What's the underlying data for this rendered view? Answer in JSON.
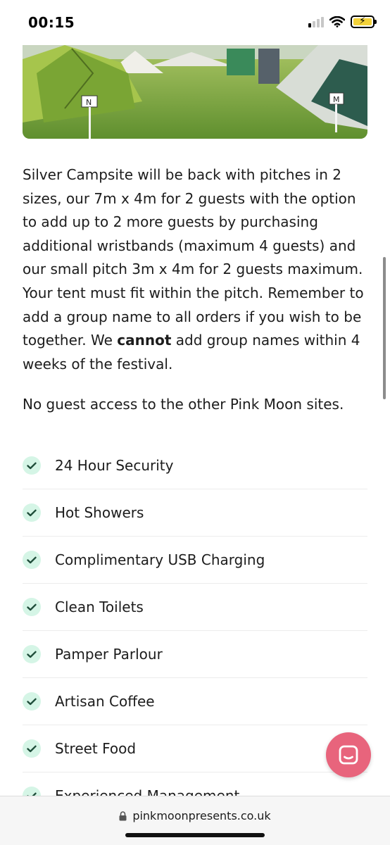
{
  "status_bar": {
    "time": "00:15"
  },
  "hero": {
    "pitch_markers": [
      "N",
      "M"
    ]
  },
  "intro": {
    "part1": "Silver Campsite will be back with pitches in 2 sizes, our 7m x 4m for 2 guests with the option to add up to 2 more guests by purchasing additional wristbands (maximum 4 guests) and our small pitch 3m x 4m for 2 guests maximum. Your tent must fit within the pitch. Remember to add a group name to all orders if you wish to be together. We ",
    "emphasis": "cannot",
    "part2": " add group names within 4 weeks of the festival."
  },
  "note": "No guest access to the other Pink Moon sites.",
  "amenities": [
    "24 Hour Security",
    "Hot Showers",
    "Complimentary USB Charging",
    "Clean Toilets",
    "Pamper Parlour",
    "Artisan Coffee",
    "Street Food",
    "Experienced Management"
  ],
  "browser": {
    "url": "pinkmoonpresents.co.uk"
  },
  "colors": {
    "accent": "#e8647c",
    "check_bg": "#d5f5e6",
    "check_icon": "#1f4d3a"
  }
}
